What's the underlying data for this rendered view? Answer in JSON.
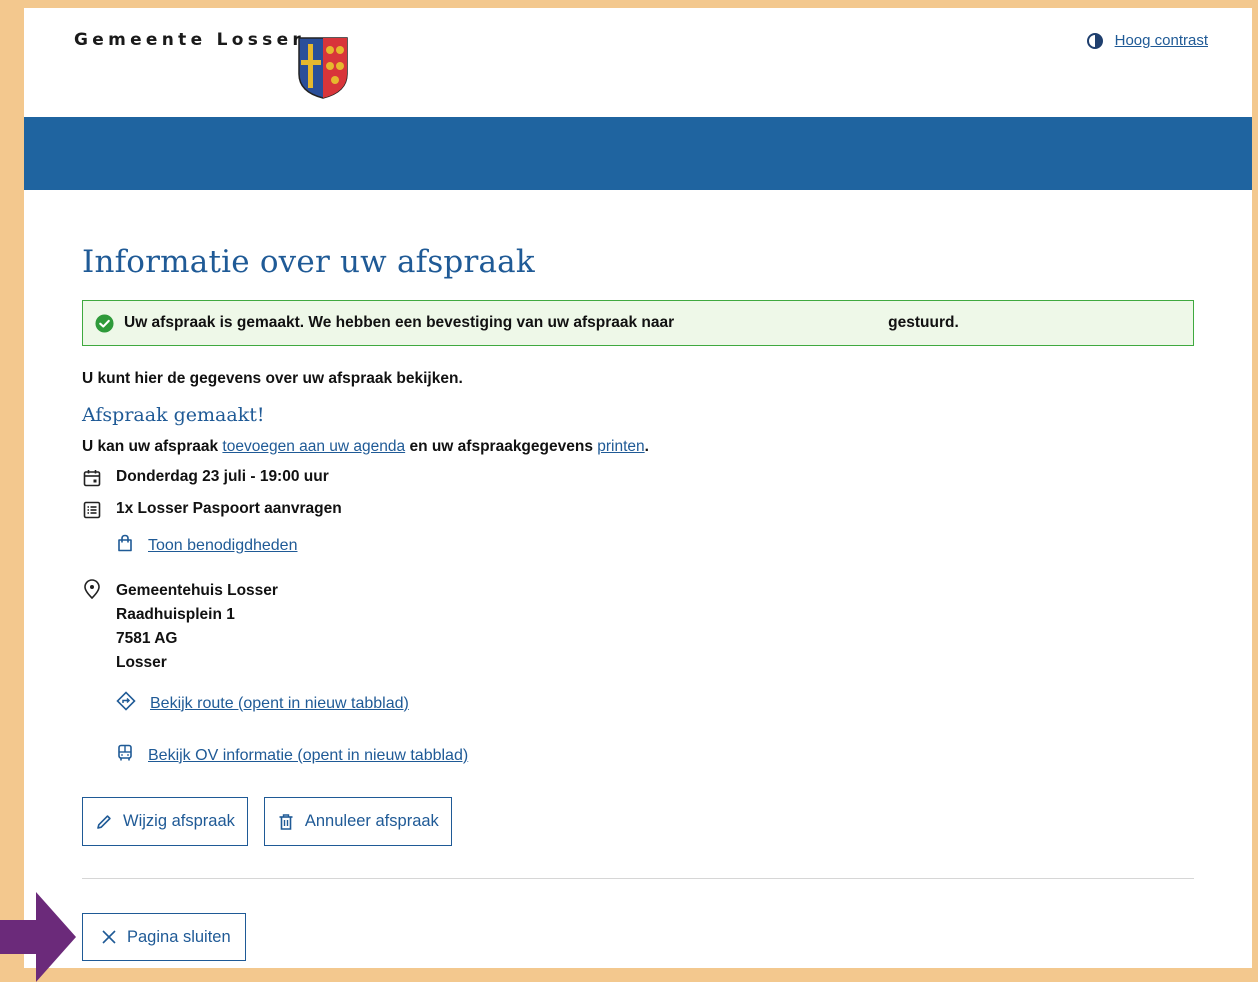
{
  "header": {
    "brand": "Gemeente Losser",
    "contrast_label": "Hoog contrast"
  },
  "page": {
    "title": "Informatie over uw afspraak",
    "alert_before": "Uw afspraak is gemaakt. We hebben een bevestiging van uw afspraak naar ",
    "alert_after": "gestuurd.",
    "intro": "U kunt hier de gegevens over uw afspraak bekijken."
  },
  "appointment": {
    "heading": "Afspraak gemaakt!",
    "add_prefix": "U kan uw afspraak ",
    "add_link": "toevoegen aan uw agenda",
    "add_middle": " en uw afspraakgegevens ",
    "print_link": "printen",
    "add_suffix": ".",
    "datetime": "Donderdag 23 juli - 19:00 uur",
    "product": "1x Losser Paspoort aanvragen",
    "requirements_link": "Toon benodigdheden",
    "location": {
      "name": "Gemeentehuis Losser",
      "street": "Raadhuisplein 1",
      "postcode": "7581 AG",
      "city": "Losser"
    },
    "route_link": "Bekijk route (opent in nieuw tabblad)",
    "ov_link": "Bekijk OV informatie (opent in nieuw tabblad)"
  },
  "actions": {
    "edit": "Wijzig afspraak",
    "cancel": "Annuleer afspraak",
    "close": "Pagina sluiten"
  },
  "colors": {
    "accent": "#1f5a96",
    "bar": "#1f64a0",
    "success": "#3fa93f",
    "frame": "#f3c88e",
    "pointer_arrow": "#6b2a7a"
  }
}
